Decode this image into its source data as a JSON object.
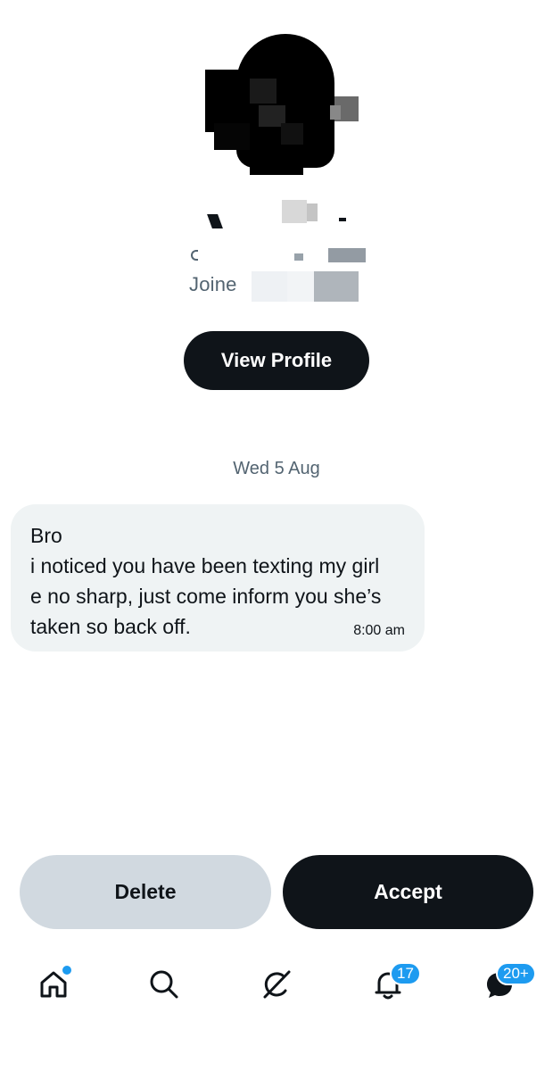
{
  "profile": {
    "joined_text": "Joine"
  },
  "view_profile_label": "View Profile",
  "conversation": {
    "date_separator": "Wed 5 Aug",
    "message": {
      "lines": [
        "Bro",
        "i noticed you have been texting my girl",
        "e no sharp, just come inform you she’s",
        "taken so back off."
      ],
      "time": "8:00 am"
    }
  },
  "actions": {
    "delete_label": "Delete",
    "accept_label": "Accept"
  },
  "nav": {
    "items": [
      {
        "name": "home",
        "icon": "home-icon",
        "has_dot": true
      },
      {
        "name": "search",
        "icon": "search-icon"
      },
      {
        "name": "grok",
        "icon": "grok-icon"
      },
      {
        "name": "notifications",
        "icon": "bell-icon",
        "badge": "17"
      },
      {
        "name": "messages",
        "icon": "messages-icon",
        "badge": "20+"
      }
    ]
  },
  "colors": {
    "accent": "#1d9bf0",
    "primary_dark": "#0f1419",
    "secondary_text": "#536471",
    "bubble_bg": "#eff3f4",
    "delete_bg": "#d1d9e0"
  }
}
